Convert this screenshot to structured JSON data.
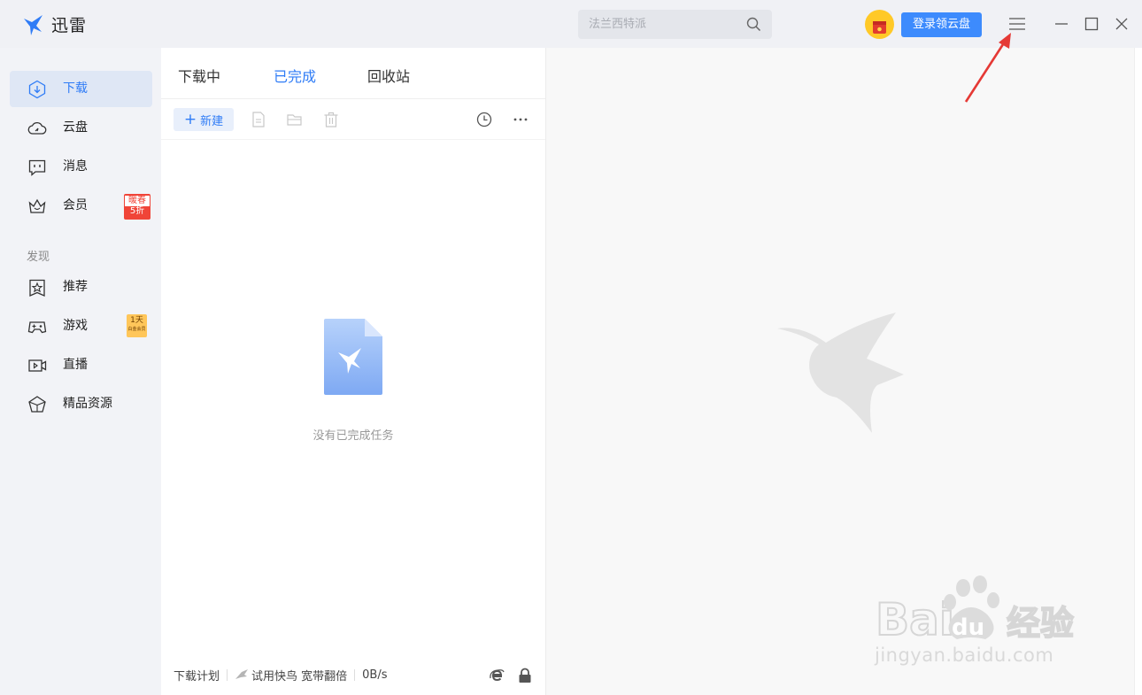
{
  "app": {
    "title": "迅雷",
    "logo_icon": "thunder-bird-icon"
  },
  "header": {
    "search_placeholder": "法兰西特派",
    "login_button": "登录领云盘"
  },
  "sidebar": {
    "items": [
      {
        "label": "下载",
        "icon": "download-icon",
        "active": true
      },
      {
        "label": "云盘",
        "icon": "cloud-icon"
      },
      {
        "label": "消息",
        "icon": "message-icon"
      },
      {
        "label": "会员",
        "icon": "crown-icon",
        "badge_line1": "暖春",
        "badge_line2": "5折"
      }
    ],
    "section_title": "发现",
    "discover_items": [
      {
        "label": "推荐",
        "icon": "star-icon"
      },
      {
        "label": "游戏",
        "icon": "gamepad-icon",
        "badge_line1": "1天",
        "badge_line2": "白金会员"
      },
      {
        "label": "直播",
        "icon": "live-icon"
      },
      {
        "label": "精品资源",
        "icon": "diamond-icon"
      }
    ]
  },
  "tabs": [
    {
      "label": "下载中"
    },
    {
      "label": "已完成",
      "active": true
    },
    {
      "label": "回收站"
    }
  ],
  "toolbar": {
    "new_label": "新建"
  },
  "empty_state": {
    "text": "没有已完成任务"
  },
  "statusbar": {
    "plan": "下载计划",
    "speedup": "试用快鸟 宽带翻倍",
    "speed": "0B/s"
  },
  "watermark": {
    "brand": "Bai du 经验",
    "url": "jingyan.baidu.com"
  },
  "colors": {
    "accent": "#2f7cf6",
    "login_bg": "#3d8bfd",
    "annotation_arrow": "#e53935"
  }
}
